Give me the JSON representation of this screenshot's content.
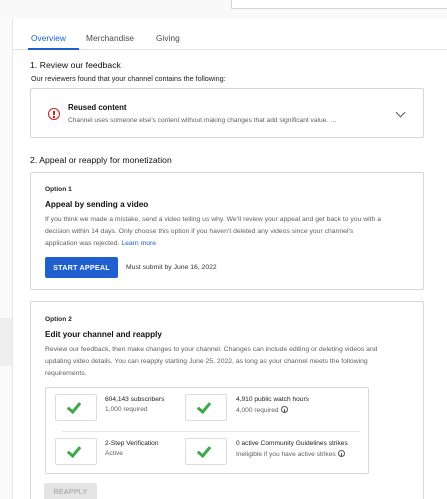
{
  "tabs": {
    "overview": "Overview",
    "merchandise": "Merchandise",
    "giving": "Giving"
  },
  "review": {
    "heading": "1. Review our feedback",
    "subheading": "Our reviewers found that your channel contains the following:",
    "issue_title": "Reused content",
    "issue_desc": "Channel uses someone else’s content without making changes that add significant value. …"
  },
  "appeal": {
    "heading": "2. Appeal or reapply for monetization",
    "option1": {
      "label": "Option 1",
      "title": "Appeal by sending a video",
      "body_line1": "If you think we made a mistake, send a video telling us why. We’ll review your appeal and get back to you with a",
      "body_line2": "decision within 14 days. Only choose this option if you haven’t deleted any videos since your channel’s",
      "body_line3": "application was rejected.",
      "learn_more": "Learn more",
      "button": "START APPEAL",
      "deadline": "Must submit by June 16, 2022"
    },
    "option2": {
      "label": "Option 2",
      "title": "Edit your channel and reapply",
      "body_line1": "Review our feedback, then make changes to your channel. Changes can include editing or deleting videos and",
      "body_line2": "updating video details. You can reapply starting June 25, 2022, as long as your channel meets the following",
      "body_line3": "requirements.",
      "requirements": [
        {
          "title": "604,143 subscribers",
          "detail": "1,000 required"
        },
        {
          "title": "4,910 public watch hours",
          "detail": "4,000 required"
        },
        {
          "title": "2-Step Verification",
          "detail": "Active"
        },
        {
          "title": "0 active Community Guidelines strikes",
          "detail": "Ineligible if you have active strikes"
        }
      ],
      "button": "REAPPLY"
    }
  },
  "colors": {
    "accent": "#1a5fd4",
    "warning": "#cc1f1f",
    "check": "#3ea84a"
  }
}
